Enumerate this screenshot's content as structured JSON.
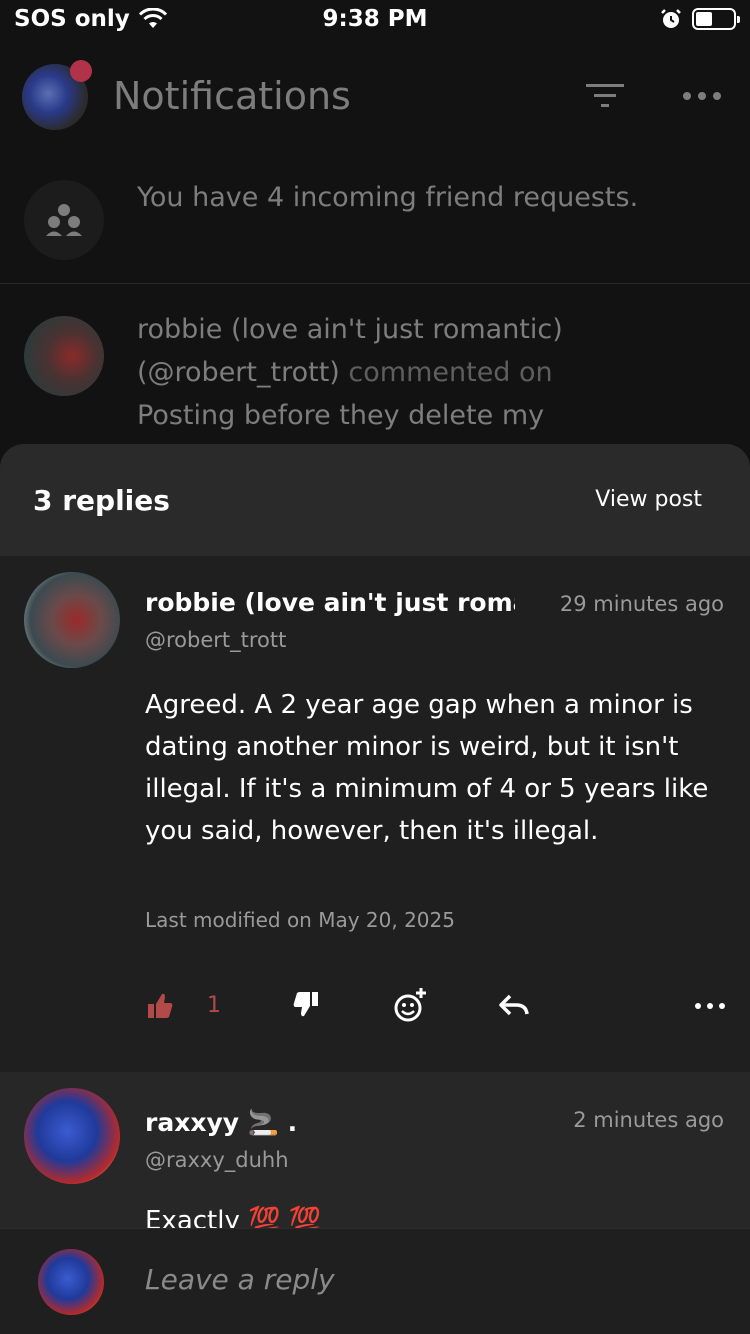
{
  "status_bar": {
    "carrier": "SOS only",
    "time": "9:38 PM"
  },
  "nav": {
    "title": "Notifications"
  },
  "notifications": [
    {
      "text": "You have 4 incoming friend requests."
    },
    {
      "name": "robbie (love ain't just romantic)",
      "handle": "(@robert_trott)",
      "action": "commented on",
      "preview": "Posting before they delete my"
    }
  ],
  "sheet": {
    "title": "3 replies",
    "view_post": "View post"
  },
  "comments": [
    {
      "name": "robbie (love ain't just romantic)",
      "handle": "@robert_trott",
      "time": "29 minutes ago",
      "body": "Agreed. A 2 year age gap when a minor is dating another minor is weird, but it isn't illegal. If it's a minimum of 4 or 5 years like you said, however, then it's illegal.",
      "meta": "Last modified on May 20, 2025",
      "likes": "1"
    },
    {
      "name": "raxxyy 🚬 .",
      "handle": "@raxxy_duhh",
      "time": "2 minutes ago",
      "body": "Exactly 💯 💯"
    }
  ],
  "reply": {
    "placeholder": "Leave a reply"
  },
  "colors": {
    "accent_like": "#b24a4a",
    "notif_dot": "#b2324a"
  }
}
